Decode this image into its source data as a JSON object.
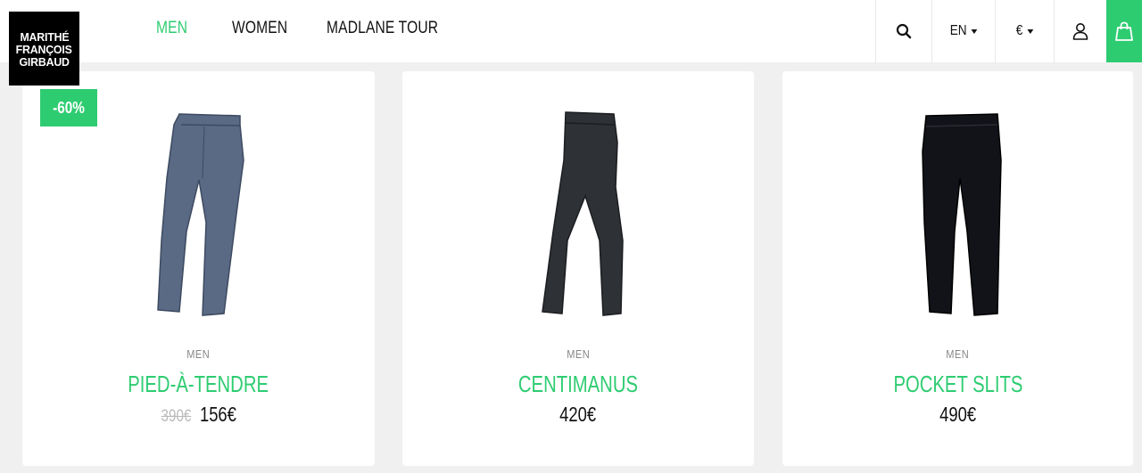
{
  "brand": {
    "logo_lines": [
      "MARITHÉ",
      "FRANÇOIS",
      "GIRBAUD"
    ]
  },
  "nav": {
    "items": [
      {
        "label": "MEN",
        "active": true
      },
      {
        "label": "WOMEN",
        "active": false
      },
      {
        "label": "MADLANE TOUR",
        "active": false
      }
    ]
  },
  "toolbar": {
    "search_icon": "search-icon",
    "language": "EN",
    "currency": "€",
    "user_icon": "user-icon",
    "cart_icon": "bag-icon"
  },
  "products": [
    {
      "category": "MEN",
      "name": "PIED-À-TENDRE",
      "old_price": "390€",
      "price": "156€",
      "badge": "-60%",
      "color": "#5a6a85"
    },
    {
      "category": "MEN",
      "name": "CENTIMANUS",
      "old_price": "",
      "price": "420€",
      "badge": "",
      "color": "#2e3136"
    },
    {
      "category": "MEN",
      "name": "POCKET SLITS",
      "old_price": "",
      "price": "490€",
      "badge": "",
      "color": "#111318"
    }
  ],
  "colors": {
    "accent": "#2ecc71",
    "background": "#f0f0f0"
  }
}
